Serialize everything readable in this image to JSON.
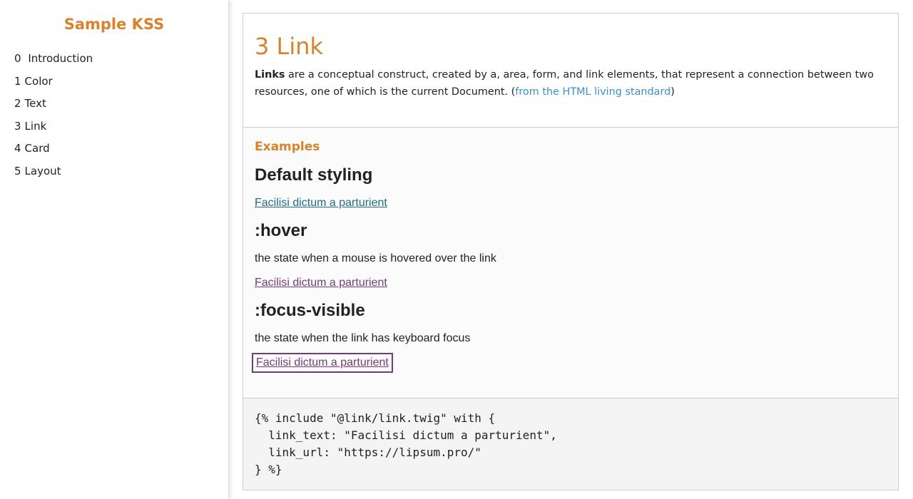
{
  "sidebar": {
    "brand": "Sample KSS",
    "items": [
      {
        "num": "0",
        "label": "Introduction"
      },
      {
        "num": "1",
        "label": "Color"
      },
      {
        "num": "2",
        "label": "Text"
      },
      {
        "num": "3",
        "label": "Link"
      },
      {
        "num": "4",
        "label": "Card"
      },
      {
        "num": "5",
        "label": "Layout"
      }
    ]
  },
  "page": {
    "title": "3 Link",
    "desc_bold": "Links",
    "desc_text": " are a conceptual construct, created by a, area, form, and link elements, that represent a connection between two resources, one of which is the current Document. (",
    "desc_link": "from the HTML living standard",
    "desc_close": ")"
  },
  "examples": {
    "heading": "Examples",
    "default_title": "Default styling",
    "link_text": "Facilisi dictum a parturient",
    "hover_title": ":hover",
    "hover_note": "the state when a mouse is hovered over the link",
    "focus_title": ":focus-visible",
    "focus_note": "the state when the link has keyboard focus"
  },
  "code": {
    "lines": [
      "{% include \"@link/link.twig\" with {",
      "  link_text: \"Facilisi dictum a parturient\",",
      "  link_url: \"https://lipsum.pro/\"",
      "} %}"
    ]
  },
  "colors": {
    "accent": "#d9822b",
    "link_default": "#1f6c86",
    "link_visited": "#743b7a",
    "doc_link": "#3a8fd0"
  }
}
